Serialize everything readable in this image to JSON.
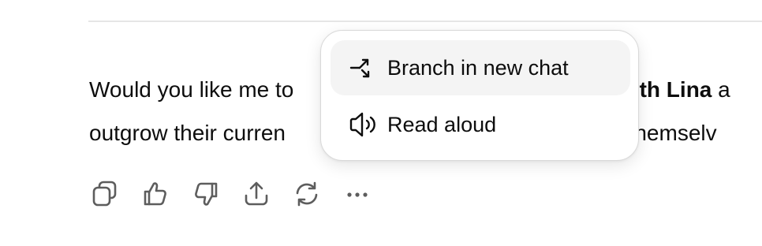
{
  "message": {
    "line1_pre": "Would you like me to",
    "line1_mid": "",
    "line1_bold": "both Lina",
    "line1_post": " a",
    "line2_pre": "outgrow their curren",
    "line2_post": "ts themselv"
  },
  "actions": {
    "items": [
      {
        "name": "copy",
        "icon": "copy-icon"
      },
      {
        "name": "good-response",
        "icon": "thumbs-up-icon"
      },
      {
        "name": "bad-response",
        "icon": "thumbs-down-icon"
      },
      {
        "name": "share",
        "icon": "share-icon"
      },
      {
        "name": "regenerate",
        "icon": "refresh-icon"
      },
      {
        "name": "more",
        "icon": "ellipsis-icon"
      }
    ]
  },
  "menu": {
    "items": [
      {
        "label": "Branch in new chat",
        "icon": "branch-icon"
      },
      {
        "label": "Read aloud",
        "icon": "speaker-icon"
      }
    ]
  }
}
